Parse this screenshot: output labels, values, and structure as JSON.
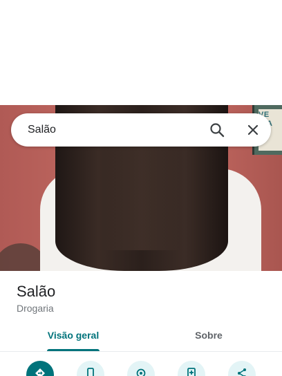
{
  "search": {
    "query": "Salão"
  },
  "photo": {
    "frame_text": "VE\nICA\nAH\nANDA AG"
  },
  "place": {
    "title": "Salão",
    "category": "Drogaria"
  },
  "tabs": [
    {
      "label": "Visão geral",
      "selected": true
    },
    {
      "label": "Sobre",
      "selected": false
    }
  ],
  "actions": [
    {
      "icon": "directions-icon"
    },
    {
      "icon": "phone-icon"
    },
    {
      "icon": "location-icon"
    },
    {
      "icon": "save-icon"
    },
    {
      "icon": "share-icon"
    }
  ],
  "colors": {
    "accent": "#00737b",
    "action_bg": "#e3f4f6"
  }
}
